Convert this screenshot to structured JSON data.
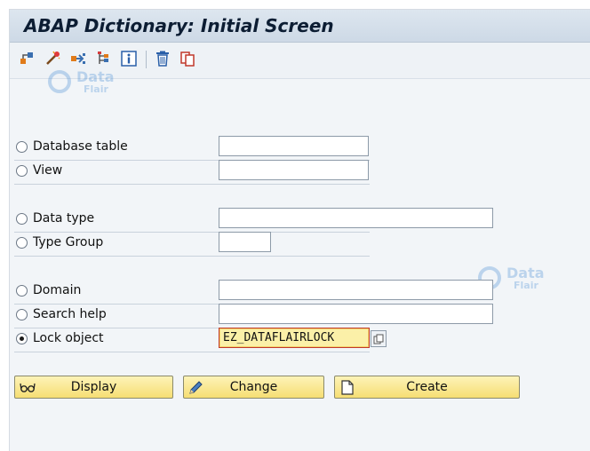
{
  "window": {
    "title": "ABAP Dictionary: Initial Screen"
  },
  "toolbar": {
    "icons": [
      "other-object-icon",
      "activate-icon",
      "where-used-icon",
      "object-list-icon",
      "info-icon",
      "delete-icon",
      "copy-icon"
    ]
  },
  "watermark": {
    "brand": "Data",
    "sub": "Flair"
  },
  "options": [
    {
      "label": "Database table",
      "value": "",
      "selected": false
    },
    {
      "label": "View",
      "value": "",
      "selected": false
    },
    {
      "label": "Data type",
      "value": "",
      "selected": false
    },
    {
      "label": "Type Group",
      "value": "",
      "selected": false
    },
    {
      "label": "Domain",
      "value": "",
      "selected": false
    },
    {
      "label": "Search help",
      "value": "",
      "selected": false
    },
    {
      "label": "Lock object",
      "value": "EZ_DATAFLAIRLOCK",
      "selected": true
    }
  ],
  "buttons": {
    "display": "Display",
    "change": "Change",
    "create": "Create"
  },
  "colors": {
    "button_fill": "#f6de73",
    "active_field": "#fbf0a8",
    "active_border": "#c0392b"
  }
}
